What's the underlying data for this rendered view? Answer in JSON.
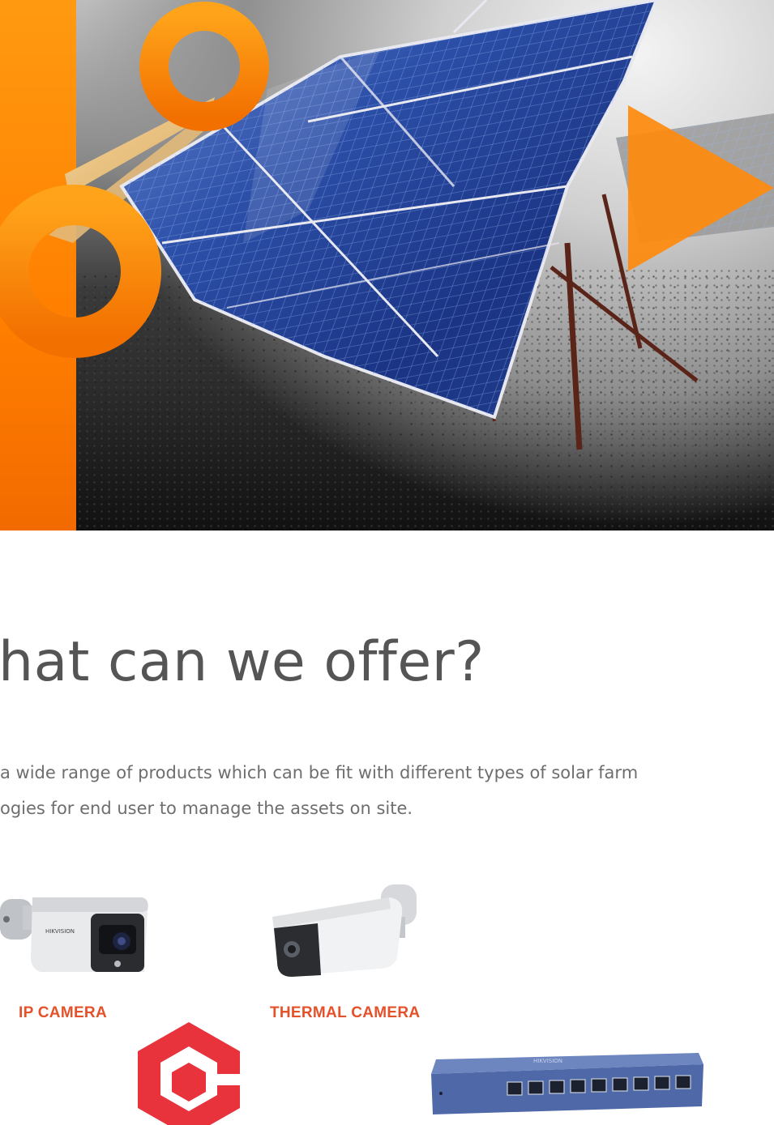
{
  "offer": {
    "title": "hat can we offer?",
    "description_lines": [
      " a wide range of products which can be fit with different types of solar farm",
      "ogies for end user to manage the assets on site."
    ]
  },
  "products": [
    {
      "label": "IP CAMERA",
      "icon": "ip-camera-icon"
    },
    {
      "label": "THERMAL CAMERA",
      "icon": "thermal-camera-icon"
    },
    {
      "label": "",
      "icon": "platform-logo-icon"
    },
    {
      "label": "",
      "icon": "poe-switch-icon"
    }
  ],
  "colors": {
    "brand_orange": "#ff8400",
    "label_orange": "#e4512b",
    "title_gray": "#555555",
    "text_gray": "#6e6e6e",
    "logo_red": "#e8323c",
    "panel_blue": "#1f3c8a"
  }
}
